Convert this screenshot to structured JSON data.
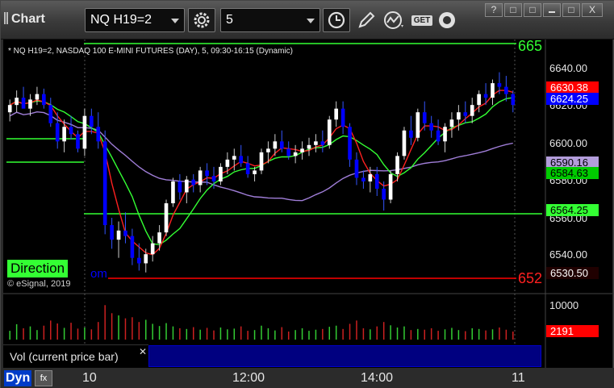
{
  "toolbar": {
    "app_title": "Chart",
    "symbol": "NQ H19=2",
    "interval": "5",
    "get_label": "GET"
  },
  "window_buttons": [
    "?",
    "□",
    "X"
  ],
  "chart_header": "* NQ H19=2, NASDAQ 100 E-MINI FUTURES (DAY), 5, 09:30-16:15 (Dynamic)",
  "copyright": "© eSignal, 2019",
  "direction_label": "Direction",
  "partial_text": {
    "right_top": "665",
    "right_bottom": "652",
    "om": "om"
  },
  "price_axis": [
    "6640.00",
    "6620.00",
    "6600.00",
    "6580.00",
    "6560.00",
    "6540.00"
  ],
  "price_tags": [
    {
      "text": "6630.38",
      "bg": "#ff0000",
      "color": "#ffffff"
    },
    {
      "text": "6624.25",
      "bg": "#0000ff",
      "color": "#ffffff"
    },
    {
      "text": "6590.16",
      "bg": "#b39ddb",
      "color": "#000000"
    },
    {
      "text": "6584.63",
      "bg": "#00cc00",
      "color": "#000000"
    },
    {
      "text": "6564.25",
      "bg": "#33ff33",
      "color": "#000000"
    },
    {
      "text": "6530.50",
      "bg": "#200000",
      "color": "#ffffff"
    }
  ],
  "volume_axis": [
    "10000"
  ],
  "volume_tag": {
    "text": "2191",
    "bg": "#ff0000",
    "color": "#ffffff"
  },
  "volume_legend": "Vol (current price bar)",
  "time_axis": [
    "10",
    "12:00",
    "14:00",
    "11"
  ],
  "dyn_label": "Dyn",
  "fx_label": "fx",
  "colors": {
    "up_candle": "#ffffff",
    "down_candle": "#0000ff",
    "ma_fast": "#ff2020",
    "ma_green": "#33ff33",
    "ma_purple": "#a07ed8",
    "level_line": "#33ff33",
    "low_line": "#ff0000"
  },
  "chart_data": {
    "type": "candlestick",
    "ylim": [
      6527,
      6652
    ],
    "candles": [
      [
        6620,
        6627,
        6615,
        6624
      ],
      [
        6624,
        6632,
        6620,
        6628
      ],
      [
        6628,
        6634,
        6625,
        6622
      ],
      [
        6622,
        6630,
        6618,
        6627
      ],
      [
        6627,
        6634,
        6624,
        6630
      ],
      [
        6630,
        6633,
        6622,
        6624
      ],
      [
        6624,
        6628,
        6612,
        6614
      ],
      [
        6614,
        6620,
        6600,
        6604
      ],
      [
        6604,
        6616,
        6598,
        6612
      ],
      [
        6612,
        6618,
        6605,
        6608
      ],
      [
        6608,
        6610,
        6598,
        6600
      ],
      [
        6600,
        6622,
        6596,
        6618
      ],
      [
        6618,
        6622,
        6608,
        6612
      ],
      [
        6612,
        6620,
        6600,
        6604
      ],
      [
        6604,
        6610,
        6553,
        6558
      ],
      [
        6558,
        6562,
        6545,
        6550
      ],
      [
        6550,
        6560,
        6540,
        6555
      ],
      [
        6555,
        6565,
        6548,
        6552
      ],
      [
        6552,
        6556,
        6536,
        6540
      ],
      [
        6540,
        6548,
        6533,
        6537
      ],
      [
        6537,
        6545,
        6532,
        6542
      ],
      [
        6542,
        6552,
        6538,
        6548
      ],
      [
        6548,
        6558,
        6544,
        6554
      ],
      [
        6554,
        6572,
        6552,
        6570
      ],
      [
        6570,
        6584,
        6568,
        6582
      ],
      [
        6582,
        6586,
        6572,
        6576
      ],
      [
        6576,
        6585,
        6570,
        6583
      ],
      [
        6583,
        6586,
        6576,
        6580
      ],
      [
        6580,
        6590,
        6576,
        6588
      ],
      [
        6588,
        6592,
        6580,
        6585
      ],
      [
        6585,
        6590,
        6578,
        6582
      ],
      [
        6582,
        6592,
        6580,
        6590
      ],
      [
        6590,
        6598,
        6586,
        6594
      ],
      [
        6594,
        6600,
        6588,
        6596
      ],
      [
        6596,
        6602,
        6590,
        6592
      ],
      [
        6592,
        6596,
        6584,
        6586
      ],
      [
        6586,
        6590,
        6582,
        6588
      ],
      [
        6588,
        6600,
        6586,
        6598
      ],
      [
        6598,
        6604,
        6592,
        6600
      ],
      [
        6600,
        6608,
        6596,
        6604
      ],
      [
        6604,
        6610,
        6598,
        6600
      ],
      [
        6600,
        6604,
        6594,
        6596
      ],
      [
        6596,
        6602,
        6592,
        6598
      ],
      [
        6598,
        6604,
        6594,
        6600
      ],
      [
        6600,
        6606,
        6596,
        6602
      ],
      [
        6602,
        6608,
        6598,
        6604
      ],
      [
        6604,
        6610,
        6598,
        6602
      ],
      [
        6602,
        6618,
        6600,
        6616
      ],
      [
        6616,
        6626,
        6612,
        6622
      ],
      [
        6622,
        6626,
        6608,
        6612
      ],
      [
        6612,
        6614,
        6590,
        6594
      ],
      [
        6594,
        6598,
        6580,
        6584
      ],
      [
        6584,
        6588,
        6578,
        6582
      ],
      [
        6582,
        6590,
        6576,
        6586
      ],
      [
        6586,
        6590,
        6574,
        6578
      ],
      [
        6578,
        6582,
        6566,
        6572
      ],
      [
        6572,
        6588,
        6570,
        6586
      ],
      [
        6586,
        6598,
        6582,
        6596
      ],
      [
        6596,
        6612,
        6594,
        6610
      ],
      [
        6610,
        6618,
        6602,
        6606
      ],
      [
        6606,
        6622,
        6604,
        6620
      ],
      [
        6620,
        6626,
        6610,
        6614
      ],
      [
        6614,
        6618,
        6606,
        6610
      ],
      [
        6610,
        6616,
        6602,
        6604
      ],
      [
        6604,
        6614,
        6598,
        6612
      ],
      [
        6612,
        6620,
        6606,
        6616
      ],
      [
        6616,
        6624,
        6610,
        6620
      ],
      [
        6620,
        6626,
        6614,
        6618
      ],
      [
        6618,
        6628,
        6614,
        6624
      ],
      [
        6624,
        6632,
        6620,
        6630
      ],
      [
        6630,
        6636,
        6624,
        6628
      ],
      [
        6628,
        6638,
        6624,
        6636
      ],
      [
        6636,
        6642,
        6630,
        6634
      ],
      [
        6634,
        6640,
        6626,
        6630
      ],
      [
        6630,
        6632,
        6620,
        6624
      ]
    ],
    "volume": [
      2400,
      4200,
      3100,
      3600,
      2600,
      3800,
      5200,
      4400,
      3200,
      4600,
      3000,
      3300,
      2800,
      4800,
      9400,
      7200,
      6600,
      5800,
      6100,
      4800,
      5400,
      4300,
      3700,
      4500,
      3600,
      3100,
      2900,
      3400,
      2700,
      3200,
      2500,
      3300,
      2800,
      3000,
      3600,
      2400,
      2600,
      3800,
      3100,
      2500,
      3400,
      2200,
      2600,
      3100,
      2400,
      2700,
      2900,
      3500,
      3800,
      2900,
      4300,
      5200,
      3100,
      2800,
      3600,
      4800,
      3900,
      3300,
      3600,
      2600,
      2900,
      2700,
      3100,
      2400,
      2800,
      3200,
      2600,
      2300,
      3100,
      2900,
      2500,
      2800,
      3300,
      2700,
      2191
    ]
  }
}
